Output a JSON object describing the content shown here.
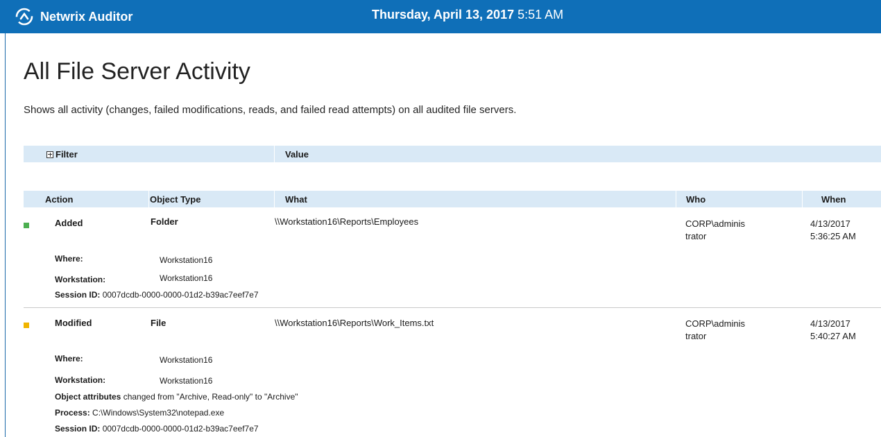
{
  "header": {
    "app_name": "Netwrix Auditor",
    "date": "Thursday, April 13, 2017",
    "time": "5:51 AM",
    "logo_icon": "netwrix-logo-icon",
    "accent_color": "#0f6fb8"
  },
  "report": {
    "title": "All File Server Activity",
    "description": "Shows all activity (changes, failed modifications, reads, and failed read attempts) on all audited file servers."
  },
  "filter_table": {
    "filter_label": "Filter",
    "value_label": "Value"
  },
  "columns": {
    "action": "Action",
    "object_type": "Object Type",
    "what": "What",
    "who": "Who",
    "when": "When"
  },
  "records": [
    {
      "marker_color": "#4caf50",
      "action": "Added",
      "object_type": "Folder",
      "what": "\\\\Workstation16\\Reports\\Employees",
      "who_line1": "CORP\\adminis",
      "who_line2": "trator",
      "when_date": "4/13/2017",
      "when_time": "5:36:25 AM",
      "where_label": "Where:",
      "where_value": "Workstation16",
      "workstation_label": "Workstation:",
      "workstation_value": "Workstation16",
      "session_label": "Session ID:",
      "session_value": "0007dcdb-0000-0000-01d2-b39ac7eef7e7"
    },
    {
      "marker_color": "#f0b400",
      "action": "Modified",
      "object_type": "File",
      "what": "\\\\Workstation16\\Reports\\Work_Items.txt",
      "who_line1": "CORP\\adminis",
      "who_line2": "trator",
      "when_date": "4/13/2017",
      "when_time": "5:40:27 AM",
      "where_label": "Where:",
      "where_value": "Workstation16",
      "workstation_label": "Workstation:",
      "workstation_value": "Workstation16",
      "attr_label": "Object attributes",
      "attr_text": "changed from \"Archive, Read-only\" to \"Archive\"",
      "process_label": "Process:",
      "process_value": "C:\\Windows\\System32\\notepad.exe",
      "session_label": "Session ID:",
      "session_value": "0007dcdb-0000-0000-01d2-b39ac7eef7e7"
    }
  ]
}
